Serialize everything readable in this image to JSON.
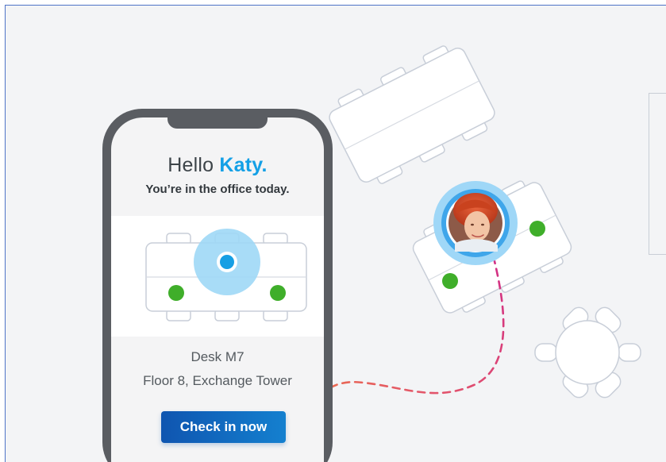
{
  "greeting": {
    "hello": "Hello ",
    "name": "Katy."
  },
  "subtitle": "You’re in the office today.",
  "desk": {
    "name": "Desk M7",
    "location": "Floor 8, Exchange Tower"
  },
  "actions": {
    "check_in_label": "Check in now"
  },
  "colors": {
    "accent": "#14a0e6",
    "button": "#1470c4",
    "available_seat": "#3fae2a",
    "route_dash": "#d12d86",
    "route_dash_start": "#f07d3a",
    "phone_body": "#5a5d62"
  },
  "icons": {
    "selected_seat": "location-dot-icon",
    "avatar": "user-avatar"
  }
}
